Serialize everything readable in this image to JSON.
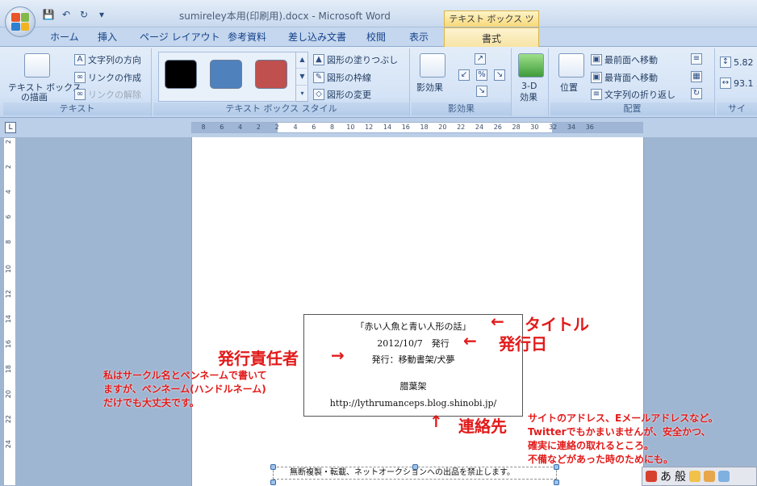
{
  "window": {
    "title": "sumireley本用(印刷用).docx - Microsoft Word",
    "context_tab_title": "テキスト ボックス ツール"
  },
  "tabs": [
    {
      "label": "ホーム"
    },
    {
      "label": "挿入"
    },
    {
      "label": "ページ レイアウト"
    },
    {
      "label": "参考資料"
    },
    {
      "label": "差し込み文書"
    },
    {
      "label": "校閲"
    },
    {
      "label": "表示"
    },
    {
      "label": "書式"
    }
  ],
  "ribbon": {
    "text_group": {
      "label": "テキスト",
      "draw_textbox": "テキスト ボックス",
      "draw_textbox_line2": "の描画",
      "text_direction": "文字列の方向",
      "create_link": "リンクの作成",
      "break_link": "リンクの解除"
    },
    "style_group": {
      "label": "テキスト ボックス スタイル",
      "fill": "図形の塗りつぶし",
      "outline": "図形の枠線",
      "change_shape": "図形の変更",
      "swatches": [
        "#000000",
        "#4f81bd",
        "#c0504d"
      ]
    },
    "shadow_group": {
      "label": "影効果",
      "button": "影効果"
    },
    "threed_group": {
      "button_line1": "3-D",
      "button_line2": "効果"
    },
    "arrange_group": {
      "label": "配置",
      "position": "位置",
      "bring_front": "最前面へ移動",
      "send_back": "最背面へ移動",
      "wrap_text": "文字列の折り返し"
    },
    "size_group": {
      "label": "サイ",
      "height": "5.82",
      "width": "93.1"
    }
  },
  "ruler": {
    "ticks": [
      "8",
      "6",
      "4",
      "2",
      "2",
      "4",
      "6",
      "8",
      "10",
      "12",
      "14",
      "16",
      "18",
      "20",
      "22",
      "24",
      "26",
      "28",
      "30",
      "32",
      "34",
      "36"
    ],
    "vticks": [
      "2",
      "2",
      "4",
      "6",
      "8",
      "10",
      "12",
      "14",
      "16",
      "18",
      "20",
      "22",
      "24"
    ]
  },
  "document": {
    "textbox": {
      "title_line": "「赤い人魚と青い人形の話」",
      "date_line": "2012/10/7　発行",
      "publisher_line": "発行：移動書架/犬夢",
      "printer_line": "腊葉架",
      "url_line": "http://lythrumanceps.blog.shinobi.jp/"
    },
    "footer": "無断複製・転載、ネットオークションへの出品を禁止します。"
  },
  "annotations": {
    "title": "タイトル",
    "date": "発行日",
    "publisher": "発行責任者",
    "contact": "連絡先",
    "left_note": [
      "私はサークル名とペンネームで書いて",
      "ますが、ペンネーム(ハンドルネーム)",
      "だけでも大丈夫です。"
    ],
    "right_note": [
      "サイトのアドレス、Eメールアドレスなど。",
      "Twitterでもかまいませんが、安全かつ、",
      "確実に連絡の取れるところ。",
      "不備などがあった時のためにも。"
    ]
  },
  "ime": {
    "mode": "あ",
    "dict": "般"
  }
}
